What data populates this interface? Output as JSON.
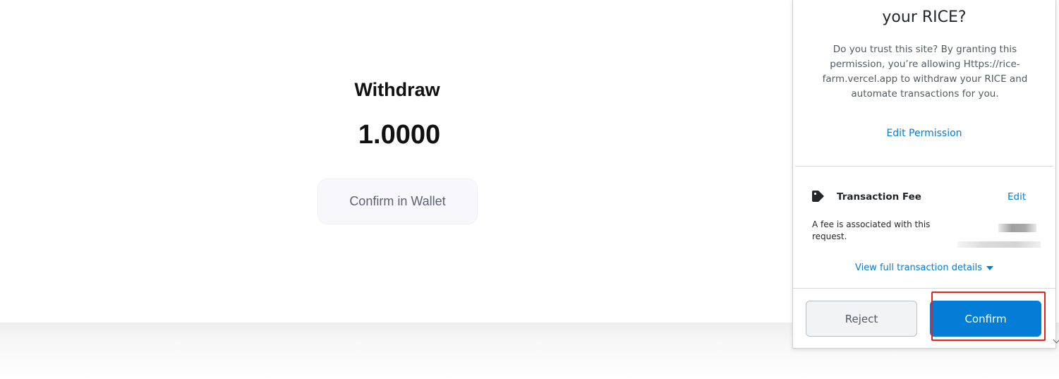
{
  "dapp": {
    "title": "Withdraw",
    "amount": "1.0000",
    "confirm_button_label": "Confirm in Wallet"
  },
  "popup": {
    "title": "your RICE?",
    "description": "Do you trust this site? By granting this permission, you’re allowing Https://rice-farm.vercel.app to withdraw your RICE and automate transactions for you.",
    "edit_permission_label": "Edit Permission",
    "fee": {
      "icon": "tag-icon",
      "title": "Transaction Fee",
      "edit_label": "Edit",
      "description": "A fee is associated with this request."
    },
    "view_details_label": "View full transaction details",
    "reject_label": "Reject",
    "confirm_label": "Confirm"
  },
  "colors": {
    "accent": "#037dd6",
    "highlight": "#e8211a"
  }
}
